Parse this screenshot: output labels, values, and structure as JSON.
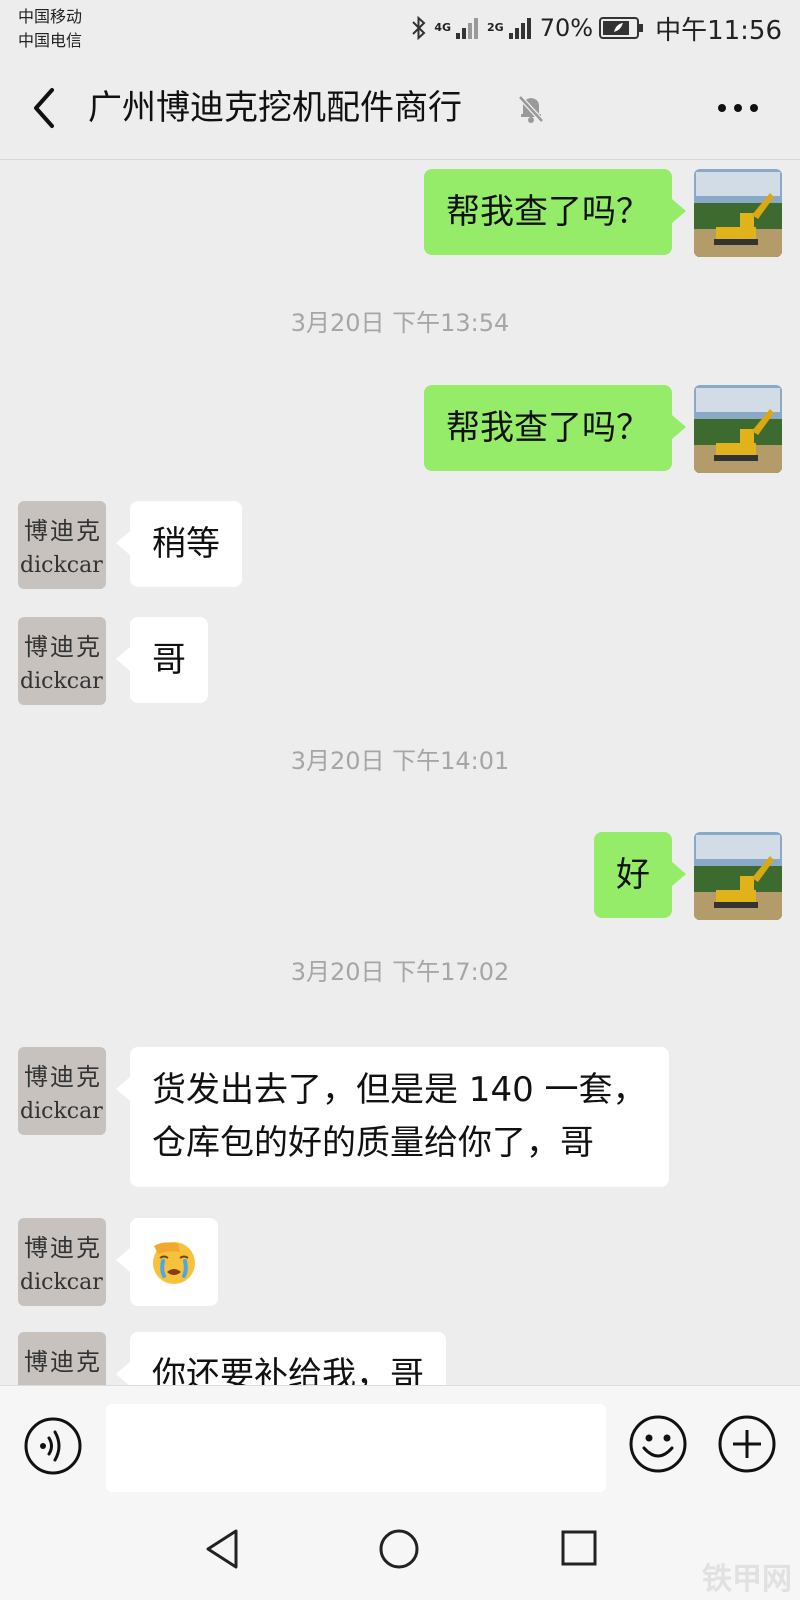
{
  "status_bar": {
    "carrier_1": "中国移动",
    "carrier_2": "中国电信",
    "net_1": "4G",
    "net_2": "2G",
    "battery": "70%",
    "time": "中午11:56"
  },
  "header": {
    "title": "广州博迪克挖机配件商行"
  },
  "avatar_text": {
    "line1": "博迪克",
    "line2": "dickcar"
  },
  "messages": [
    {
      "type": "sent",
      "text": "帮我查了吗？"
    },
    {
      "type": "time",
      "text": "3月20日 下午13:54"
    },
    {
      "type": "sent",
      "text": "帮我查了吗？"
    },
    {
      "type": "received",
      "text": "稍等"
    },
    {
      "type": "received",
      "text": "哥"
    },
    {
      "type": "time",
      "text": "3月20日 下午14:01"
    },
    {
      "type": "sent",
      "text": "好"
    },
    {
      "type": "time",
      "text": "3月20日 下午17:02"
    },
    {
      "type": "received",
      "line1": "货发出去了，但是是 140 一套，",
      "line2": "仓库包的好的质量给你了，哥"
    },
    {
      "type": "received",
      "emoji": "face-palm-crying"
    },
    {
      "type": "received",
      "text": "你还要补给我，哥"
    }
  ],
  "input": {
    "value": "",
    "placeholder": ""
  },
  "icons": {
    "back": "chevron-left-icon",
    "mute": "bell-slash-icon",
    "more": "more-dots-icon",
    "voice": "voice-icon",
    "emoji": "smiley-icon",
    "plus": "plus-circle-icon"
  },
  "colors": {
    "sent_bubble": "#95ec69",
    "received_bubble": "#ffffff",
    "background": "#ededed"
  },
  "watermark": "铁甲网"
}
